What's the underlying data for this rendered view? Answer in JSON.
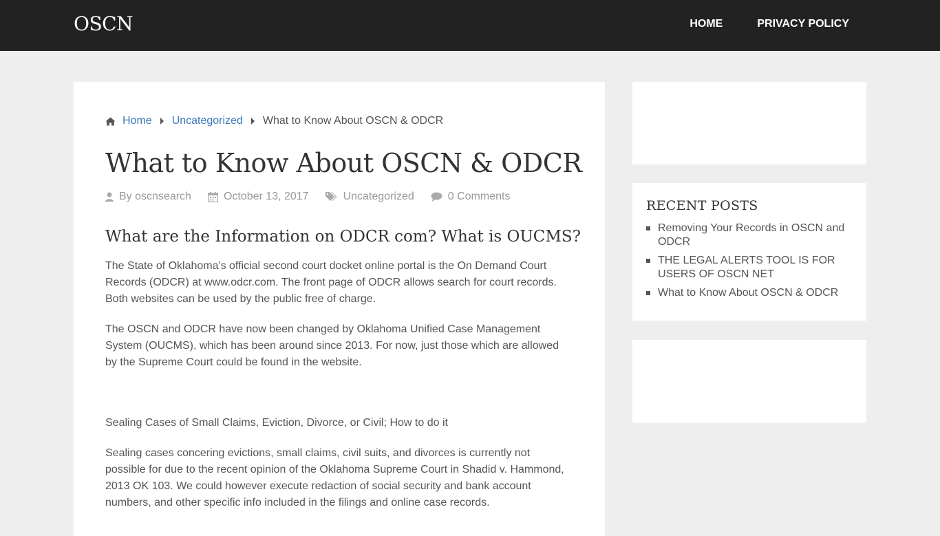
{
  "header": {
    "site_title": "OSCN",
    "nav": [
      {
        "label": "HOME"
      },
      {
        "label": "PRIVACY POLICY"
      }
    ]
  },
  "breadcrumb": {
    "home": "Home",
    "category": "Uncategorized",
    "current": "What to Know About OSCN & ODCR"
  },
  "post": {
    "title": "What to Know About OSCN & ODCR",
    "meta": {
      "author": "By oscnsearch",
      "date": "October 13, 2017",
      "category": "Uncategorized",
      "comments": "0 Comments"
    },
    "heading": "What are the Information on ODCR com? What is OUCMS?",
    "paragraphs": [
      "The State of Oklahoma's official second court docket online portal is the On Demand Court Records (ODCR) at www.odcr.com. The front page of ODCR allows search for court records. Both websites can be used by the public free of charge.",
      "The OSCN and ODCR have now been changed by Oklahoma Unified Case Management System (OUCMS), which has been around since 2013. For now, just those which are allowed by the Supreme Court could be found in the website.",
      "Sealing Cases of Small Claims, Eviction, Divorce, or Civil; How to do it",
      "Sealing cases concering evictions, small claims, civil suits, and divorces is currently not possible for due to the recent opinion of the Oklahoma Supreme Court in Shadid v. Hammond, 2013 OK 103. We could however execute redaction of social security and bank account numbers, and other specific info included in the filings and online case records."
    ]
  },
  "sidebar": {
    "recent_title": "RECENT POSTS",
    "recent_posts": [
      "Removing Your Records in OSCN and ODCR",
      "THE LEGAL ALERTS TOOL IS FOR USERS OF OSCN NET",
      "What to Know About OSCN & ODCR"
    ]
  },
  "icons": {
    "home": "home-icon",
    "breadcrumb_separator": "caret-right-icon",
    "author": "user-icon",
    "date": "calendar-icon",
    "category": "tags-icon",
    "comments": "comment-icon"
  },
  "colors": {
    "header_bg": "#222222",
    "page_bg": "#eeeeee",
    "link": "#3a77b8",
    "meta": "#999999"
  }
}
